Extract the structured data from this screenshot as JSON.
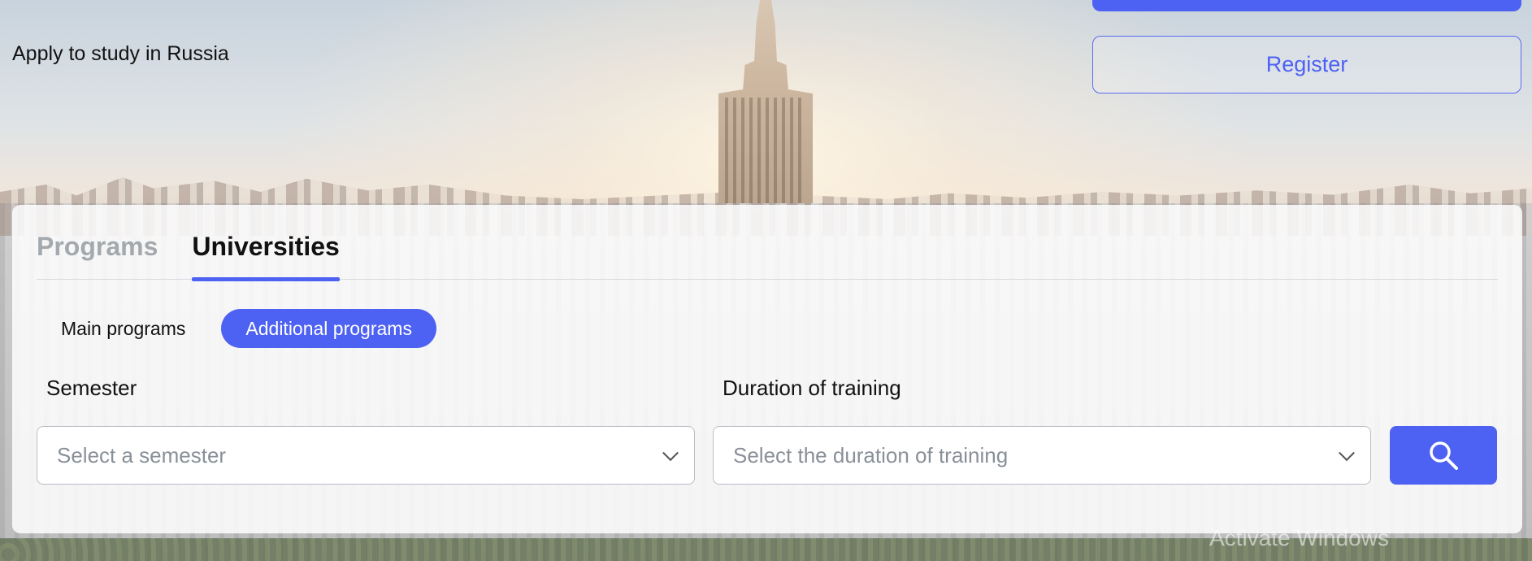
{
  "header": {
    "tagline": "Apply to study in Russia",
    "register_label": "Register"
  },
  "search": {
    "tabs": [
      {
        "label": "Programs",
        "active": false
      },
      {
        "label": "Universities",
        "active": true
      }
    ],
    "program_types": [
      {
        "label": "Main programs",
        "active": false
      },
      {
        "label": "Additional programs",
        "active": true
      }
    ],
    "semester": {
      "label": "Semester",
      "placeholder": "Select a semester"
    },
    "duration": {
      "label": "Duration of training",
      "placeholder": "Select the duration of training"
    },
    "search_button_icon": "search-icon"
  },
  "system": {
    "watermark": "Activate Windows"
  },
  "colors": {
    "accent": "#4d61f2",
    "text": "#111111",
    "inactive_tab": "#a4a9ae",
    "placeholder": "#8a9098"
  }
}
